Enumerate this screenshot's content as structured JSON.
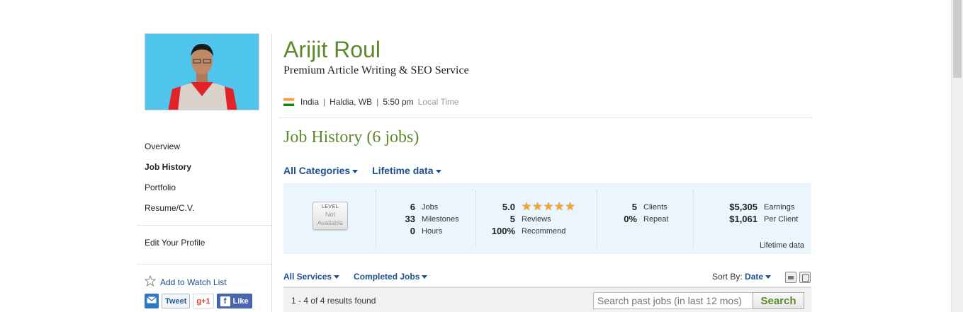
{
  "profile": {
    "name": "Arijit Roul",
    "tagline": "Premium Article Writing & SEO Service",
    "country": "India",
    "city": "Haldia, WB",
    "time": "5:50 pm",
    "time_suffix": "Local Time"
  },
  "sidebar": {
    "items": [
      {
        "label": "Overview"
      },
      {
        "label": "Job History"
      },
      {
        "label": "Portfolio"
      },
      {
        "label": "Resume/C.V."
      }
    ],
    "edit_profile": "Edit Your Profile",
    "watch_list": "Add to Watch List",
    "share": {
      "tweet": "Tweet",
      "gplus": "+1",
      "like": "Like"
    }
  },
  "section_title": "Job History (6 jobs)",
  "filters": {
    "categories": "All Categories",
    "period": "Lifetime data"
  },
  "stats": {
    "level": {
      "title": "LEVEL",
      "line1": "Not",
      "line2": "Available"
    },
    "jobs": {
      "value": "6",
      "label": "Jobs"
    },
    "milestones": {
      "value": "33",
      "label": "Milestones"
    },
    "hours": {
      "value": "0",
      "label": "Hours"
    },
    "rating": {
      "value": "5.0",
      "stars": 5
    },
    "reviews": {
      "value": "5",
      "label": "Reviews"
    },
    "recommend": {
      "value": "100%",
      "label": "Recommend"
    },
    "clients": {
      "value": "5",
      "label": "Clients"
    },
    "repeat": {
      "value": "0%",
      "label": "Repeat"
    },
    "earnings": {
      "value": "$5,305",
      "label": "Earnings"
    },
    "per_client": {
      "value": "$1,061",
      "label": "Per Client"
    },
    "note": "Lifetime data"
  },
  "list_filters": {
    "services": "All Services",
    "status": "Completed Jobs"
  },
  "sort": {
    "label": "Sort By:",
    "value": "Date"
  },
  "results": {
    "count": "1 - 4 of 4 results found"
  },
  "search": {
    "placeholder": "Search past jobs (in last 12 mos)",
    "button": "Search"
  },
  "colors": {
    "accent_green": "#5c8a2b",
    "link_blue": "#1f4f8f",
    "panel_bg": "#eaf5fc"
  }
}
